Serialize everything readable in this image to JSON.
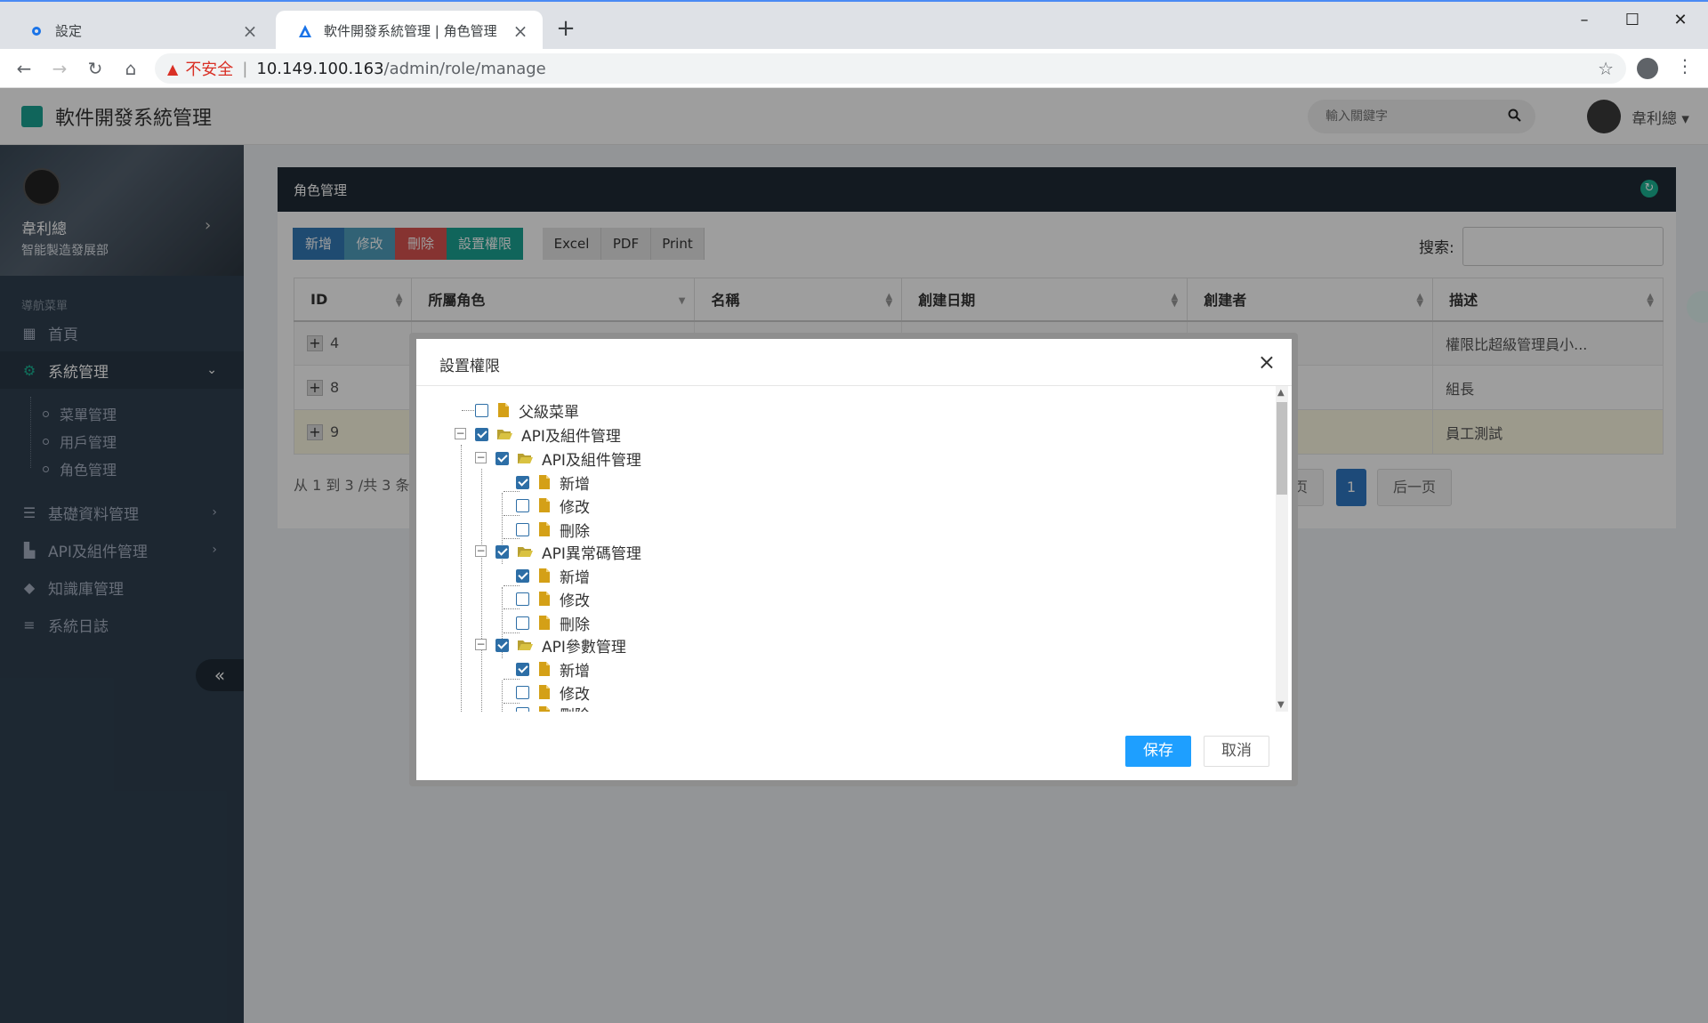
{
  "browser": {
    "tabs": [
      {
        "title": "設定",
        "icon": "gear-icon"
      },
      {
        "title": "軟件開發系統管理 | 角色管理",
        "icon": "app-triangle-icon"
      }
    ],
    "address": {
      "warning": "不安全",
      "host": "10.149.100.163",
      "path": "/admin/role/manage"
    }
  },
  "header": {
    "title": "軟件開發系統管理",
    "search_placeholder": "輸入關鍵字",
    "user": "韋利總"
  },
  "sidebar": {
    "profile": {
      "name": "韋利總",
      "department": "智能製造發展部"
    },
    "heading": "導航菜單",
    "items": [
      {
        "label": "首頁",
        "icon": "dashboard-icon"
      },
      {
        "label": "系統管理",
        "icon": "gears-icon"
      },
      {
        "label": "基礎資料管理",
        "icon": "list-icon"
      },
      {
        "label": "API及組件管理",
        "icon": "puzzle-icon"
      },
      {
        "label": "知識庫管理",
        "icon": "tag-icon"
      },
      {
        "label": "系統日誌",
        "icon": "log-icon"
      }
    ],
    "sub_items": [
      "菜單管理",
      "用戶管理",
      "角色管理"
    ]
  },
  "panel": {
    "title": "角色管理",
    "buttons": {
      "add": "新增",
      "edit": "修改",
      "delete": "刪除",
      "permissions": "設置權限",
      "excel": "Excel",
      "pdf": "PDF",
      "print": "Print"
    },
    "search_label": "搜索:",
    "table": {
      "columns": [
        "ID",
        "所屬角色",
        "名稱",
        "創建日期",
        "創建者",
        "描述"
      ],
      "rows": [
        {
          "id": "4",
          "description": "權限比超級管理員小..."
        },
        {
          "id": "8",
          "description": "組長"
        },
        {
          "id": "9",
          "description": "員工測試"
        }
      ]
    },
    "footer_info": "从 1 到 3 /共 3 条",
    "pagination": {
      "prev": "前一页",
      "current": "1",
      "next": "后一页"
    }
  },
  "modal": {
    "title": "設置權限",
    "tree": [
      {
        "label": "父級菜單",
        "checked": false
      },
      {
        "label": "API及組件管理",
        "checked": true
      },
      {
        "label": "API及組件管理",
        "checked": true
      },
      {
        "label": "新增",
        "checked": true
      },
      {
        "label": "修改",
        "checked": false
      },
      {
        "label": "刪除",
        "checked": false
      },
      {
        "label": "API異常碼管理",
        "checked": true
      },
      {
        "label": "新增",
        "checked": true
      },
      {
        "label": "修改",
        "checked": false
      },
      {
        "label": "刪除",
        "checked": false
      },
      {
        "label": "API參數管理",
        "checked": true
      },
      {
        "label": "新增",
        "checked": true
      },
      {
        "label": "修改",
        "checked": false
      },
      {
        "label": "刪除",
        "checked": false
      }
    ],
    "save": "保存",
    "cancel": "取消"
  },
  "colors": {
    "sidebar_bg": "#2f4050",
    "primary_blue": "#2f78c4",
    "teal": "#1aa394",
    "danger": "#d9534f",
    "save_blue": "#1e9fff"
  }
}
